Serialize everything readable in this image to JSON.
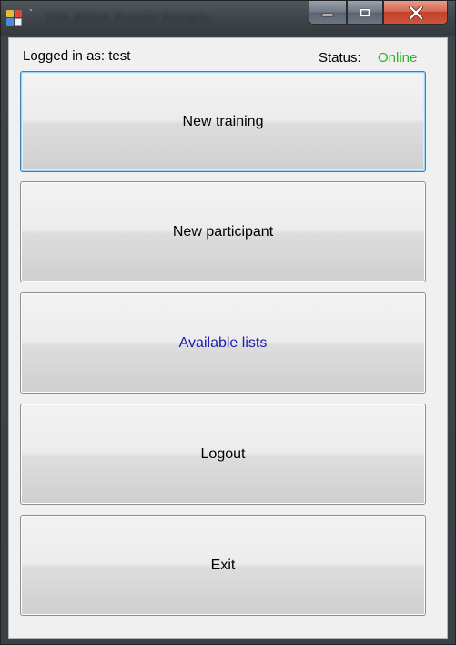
{
  "titlebar": {
    "title": "`",
    "background_menu_text": "Plik   Widok   Projekt   Kompilu",
    "controls": {
      "minimize_icon": "minimize-icon",
      "maximize_icon": "maximize-icon",
      "close_icon": "close-icon"
    }
  },
  "header": {
    "logged_in": "Logged in as: test",
    "status_label": "Status:",
    "status_value": "Online",
    "status_color": "#22bb22"
  },
  "buttons": [
    {
      "label": "New training",
      "focused": true
    },
    {
      "label": "New participant",
      "focused": false
    },
    {
      "label": "Available lists",
      "focused": false,
      "color": "#1a1ab0"
    },
    {
      "label": "Logout",
      "focused": false
    },
    {
      "label": "Exit",
      "focused": false
    }
  ]
}
